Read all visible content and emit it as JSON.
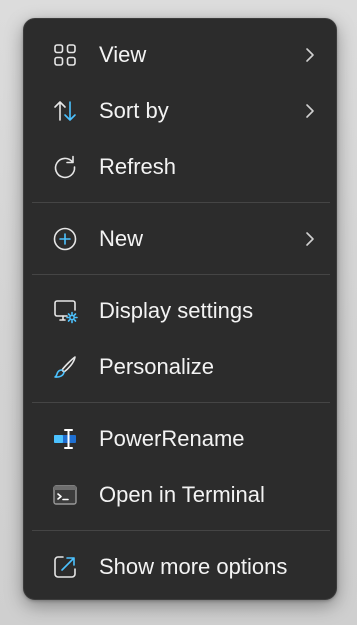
{
  "menu": {
    "items": [
      {
        "label": "View",
        "icon": "grid-view-icon",
        "submenu": true
      },
      {
        "label": "Sort by",
        "icon": "sort-arrows-icon",
        "submenu": true
      },
      {
        "label": "Refresh",
        "icon": "refresh-icon",
        "submenu": false
      },
      {
        "label": "New",
        "icon": "plus-circle-icon",
        "submenu": true
      },
      {
        "label": "Display settings",
        "icon": "display-settings-icon",
        "submenu": false
      },
      {
        "label": "Personalize",
        "icon": "paintbrush-icon",
        "submenu": false
      },
      {
        "label": "PowerRename",
        "icon": "powerrename-icon",
        "submenu": false
      },
      {
        "label": "Open in Terminal",
        "icon": "terminal-icon",
        "submenu": false
      },
      {
        "label": "Show more options",
        "icon": "share-external-icon",
        "submenu": false
      }
    ]
  },
  "colors": {
    "menu_background": "#2c2c2c",
    "text": "#f3f3f3",
    "accent": "#4cc2ff",
    "icon_stroke": "#e6e6e6",
    "separator": "#454545"
  }
}
